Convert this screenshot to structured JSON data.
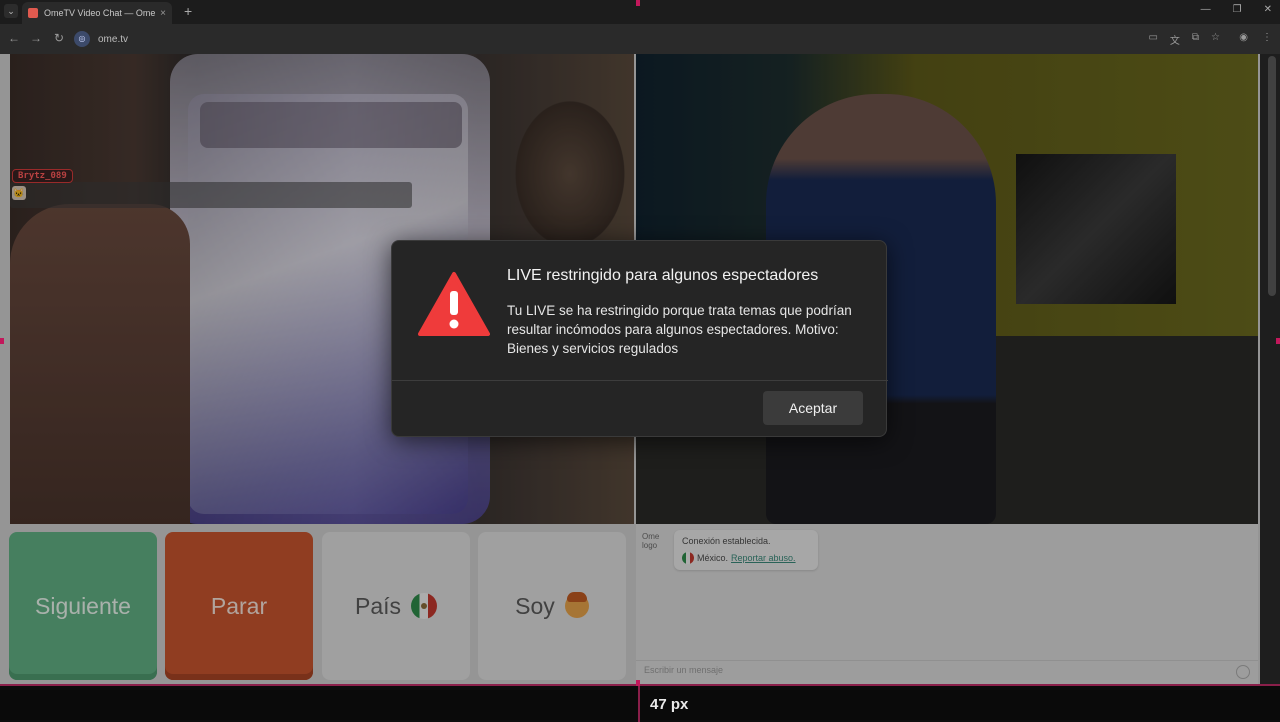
{
  "browser": {
    "tab_title": "OmeTV Video Chat — Ome",
    "tab_close": "×",
    "new_tab": "+",
    "url": "ome.tv",
    "site_icon": "◎",
    "win_minimize": "—",
    "win_restore": "❐",
    "win_close": "✕",
    "back": "←",
    "forward": "→",
    "reload": "↻"
  },
  "video": {
    "username": "Brytz_089",
    "avatar_glyph": "🐱"
  },
  "buttons": {
    "next": "Siguiente",
    "stop": "Parar",
    "country": "País",
    "iam": "Soy"
  },
  "chat": {
    "logo_alt": "Ome logo",
    "connected": "Conexión establecida.",
    "country": "México.",
    "report": "Reportar abuso.",
    "input_placeholder": "Escribir un mensaje"
  },
  "modal": {
    "title": "LIVE restringido para algunos espectadores",
    "body": "Tu LIVE se ha restringido porque trata temas que podrían resultar incómodos para algunos espectadores. Motivo: Bienes y servicios regulados",
    "accept": "Aceptar",
    "warning_color": "#ef3b3b"
  },
  "measure": {
    "label": "47 px"
  }
}
